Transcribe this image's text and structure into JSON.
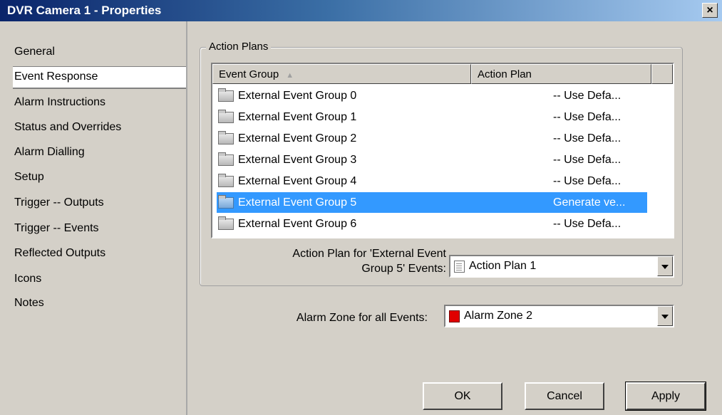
{
  "window": {
    "title": "DVR Camera 1 - Properties",
    "close_label": "×"
  },
  "sidebar": {
    "items": [
      {
        "label": "General"
      },
      {
        "label": "Event Response",
        "selected": true
      },
      {
        "label": "Alarm Instructions"
      },
      {
        "label": "Status and Overrides"
      },
      {
        "label": "Alarm Dialling"
      },
      {
        "label": "Setup"
      },
      {
        "label": "Trigger -- Outputs"
      },
      {
        "label": "Trigger -- Events"
      },
      {
        "label": "Reflected Outputs"
      },
      {
        "label": "Icons"
      },
      {
        "label": "Notes"
      }
    ]
  },
  "action_plans": {
    "group_label": "Action Plans",
    "columns": {
      "event_group": "Event Group",
      "action_plan": "Action Plan"
    },
    "rows": [
      {
        "name": "External Event Group 0",
        "plan": "-- Use Defa..."
      },
      {
        "name": "External Event Group 1",
        "plan": "-- Use Defa..."
      },
      {
        "name": "External Event Group 2",
        "plan": "-- Use Defa..."
      },
      {
        "name": "External Event Group 3",
        "plan": "-- Use Defa..."
      },
      {
        "name": "External Event Group 4",
        "plan": "-- Use Defa..."
      },
      {
        "name": "External Event Group 5",
        "plan": "Generate ve...",
        "selected": true
      },
      {
        "name": "External Event Group 6",
        "plan": "-- Use Defa..."
      }
    ],
    "plan_label_line1": "Action Plan for 'External Event",
    "plan_label_line2": "Group 5' Events:",
    "plan_value": "Action Plan 1"
  },
  "alarm_zone": {
    "label": "Alarm Zone for all Events:",
    "value": "Alarm Zone 2",
    "color": "#e00000"
  },
  "buttons": {
    "ok": "OK",
    "cancel": "Cancel",
    "apply": "Apply"
  }
}
